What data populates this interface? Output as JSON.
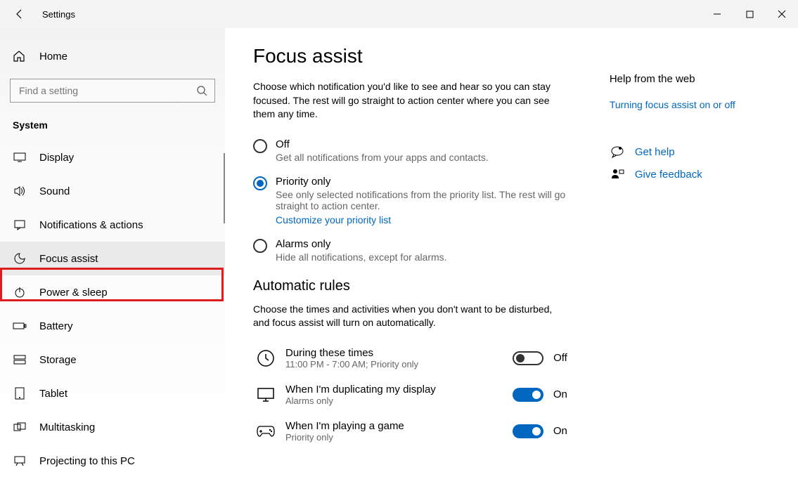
{
  "window": {
    "title": "Settings"
  },
  "sidebar": {
    "home": "Home",
    "search_placeholder": "Find a setting",
    "category": "System",
    "items": [
      {
        "label": "Display"
      },
      {
        "label": "Sound"
      },
      {
        "label": "Notifications & actions"
      },
      {
        "label": "Focus assist"
      },
      {
        "label": "Power & sleep"
      },
      {
        "label": "Battery"
      },
      {
        "label": "Storage"
      },
      {
        "label": "Tablet"
      },
      {
        "label": "Multitasking"
      },
      {
        "label": "Projecting to this PC"
      }
    ]
  },
  "main": {
    "title": "Focus assist",
    "description": "Choose which notification you'd like to see and hear so you can stay focused. The rest will go straight to action center where you can see them any time.",
    "options": {
      "off": {
        "title": "Off",
        "sub": "Get all notifications from your apps and contacts."
      },
      "priority": {
        "title": "Priority only",
        "sub": "See only selected notifications from the priority list. The rest will go straight to action center.",
        "link": "Customize your priority list"
      },
      "alarms": {
        "title": "Alarms only",
        "sub": "Hide all notifications, except for alarms."
      }
    },
    "rules_heading": "Automatic rules",
    "rules_desc": "Choose the times and activities when you don't want to be disturbed, and focus assist will turn on automatically.",
    "rules": {
      "times": {
        "title": "During these times",
        "sub": "11:00 PM - 7:00 AM; Priority only",
        "state": "Off"
      },
      "display": {
        "title": "When I'm duplicating my display",
        "sub": "Alarms only",
        "state": "On"
      },
      "game": {
        "title": "When I'm playing a game",
        "sub": "Priority only",
        "state": "On"
      }
    }
  },
  "help": {
    "heading": "Help from the web",
    "link1": "Turning focus assist on or off",
    "get_help": "Get help",
    "feedback": "Give feedback"
  }
}
